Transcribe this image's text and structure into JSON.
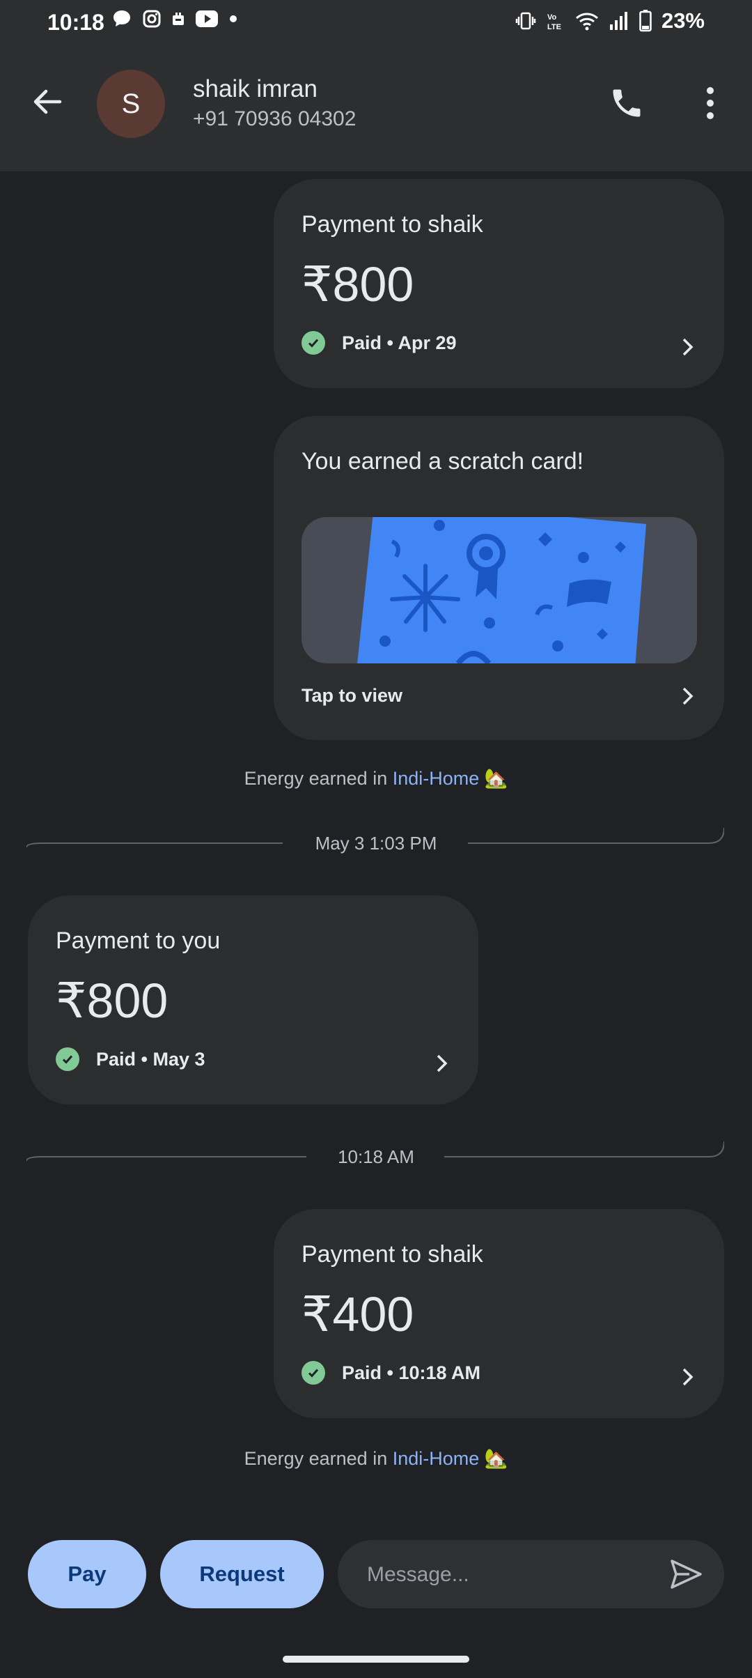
{
  "status_bar": {
    "time": "10:18",
    "battery": "23%"
  },
  "contact": {
    "initial": "S",
    "name": "shaik imran",
    "phone": "+91 70936 04302"
  },
  "messages": [
    {
      "title": "Payment to shaik",
      "amount": "₹800",
      "status": "Paid • Apr 29"
    },
    {
      "title": "You earned a scratch card!",
      "action": "Tap to view"
    },
    {
      "title": "Payment to you",
      "amount": "₹800",
      "status": "Paid • May 3"
    },
    {
      "title": "Payment to shaik",
      "amount": "₹400",
      "status": "Paid • 10:18 AM"
    }
  ],
  "energy_note": {
    "prefix": "Energy earned in",
    "link": "Indi-Home",
    "emoji": "🏡"
  },
  "dividers": [
    "May 3 1:03 PM",
    "10:18 AM"
  ],
  "composer": {
    "pay_label": "Pay",
    "request_label": "Request",
    "message_placeholder": "Message..."
  },
  "colors": {
    "background": "#202124",
    "card": "#2c2d2f",
    "accent": "#a8c7fa",
    "paid_check": "#81c995",
    "link": "#8ab4f8",
    "scratch_card": "#3b82f6"
  }
}
